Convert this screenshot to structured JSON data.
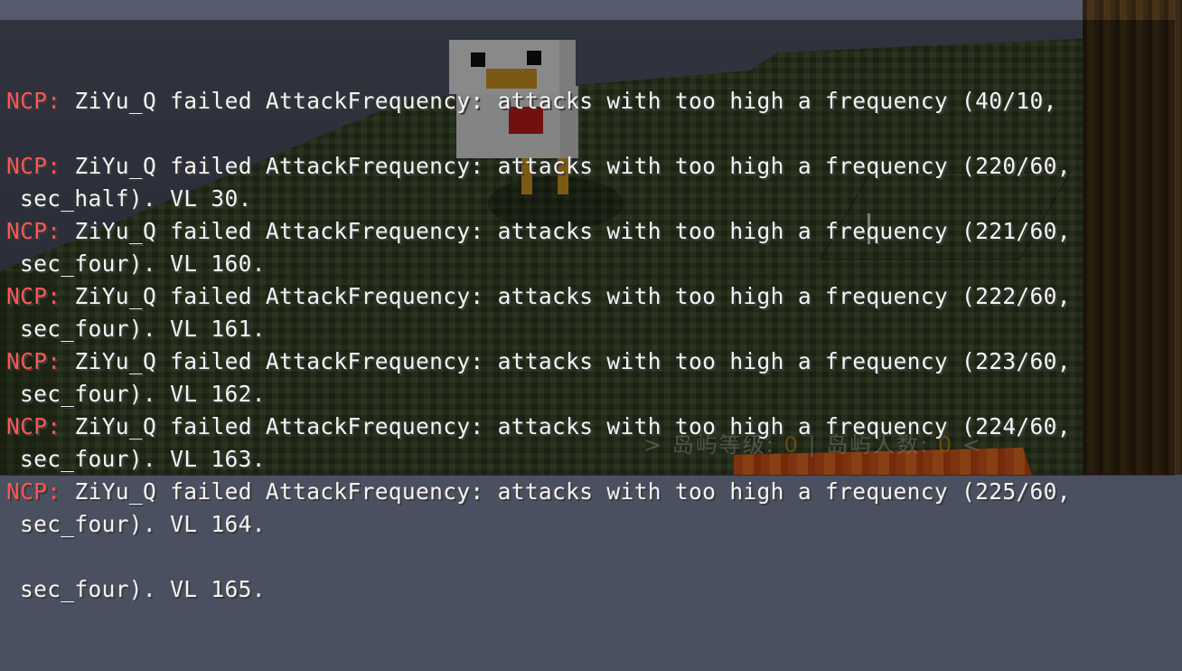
{
  "hud": {
    "level_label": "岛屿等级: ",
    "level_value": "0",
    "separator": " | ",
    "count_label": "岛屿人数: ",
    "count_value": "0",
    "left_chevron": "> ",
    "right_chevron": " <"
  },
  "chat": {
    "messages": [
      {
        "prefix": "NCP:",
        "text": " ZiYu_Q failed AttackFrequency: attacks with too high a frequency (40/10,",
        "continuation": "sec_half). VL 30."
      },
      {
        "prefix": "NCP:",
        "text": " ZiYu_Q failed AttackFrequency: attacks with too high a frequency (220/60,",
        "continuation": "sec_four). VL 160."
      },
      {
        "prefix": "NCP:",
        "text": " ZiYu_Q failed AttackFrequency: attacks with too high a frequency (221/60,",
        "continuation": "sec_four). VL 161."
      },
      {
        "prefix": "NCP:",
        "text": " ZiYu_Q failed AttackFrequency: attacks with too high a frequency (222/60,",
        "continuation": "sec_four). VL 162."
      },
      {
        "prefix": "NCP:",
        "text": " ZiYu_Q failed AttackFrequency: attacks with too high a frequency (223/60,",
        "continuation": "sec_four). VL 163."
      },
      {
        "prefix": "NCP:",
        "text": " ZiYu_Q failed AttackFrequency: attacks with too high a frequency (224/60,",
        "continuation": "sec_four). VL 164."
      },
      {
        "prefix": "NCP:",
        "text": " ZiYu_Q failed AttackFrequency: attacks with too high a frequency (225/60,",
        "continuation": "sec_four). VL 165."
      }
    ]
  },
  "colors": {
    "ncp_prefix": "#ff5555",
    "chat_text": "#f4f4f4",
    "hud_value": "#ffaa00"
  }
}
